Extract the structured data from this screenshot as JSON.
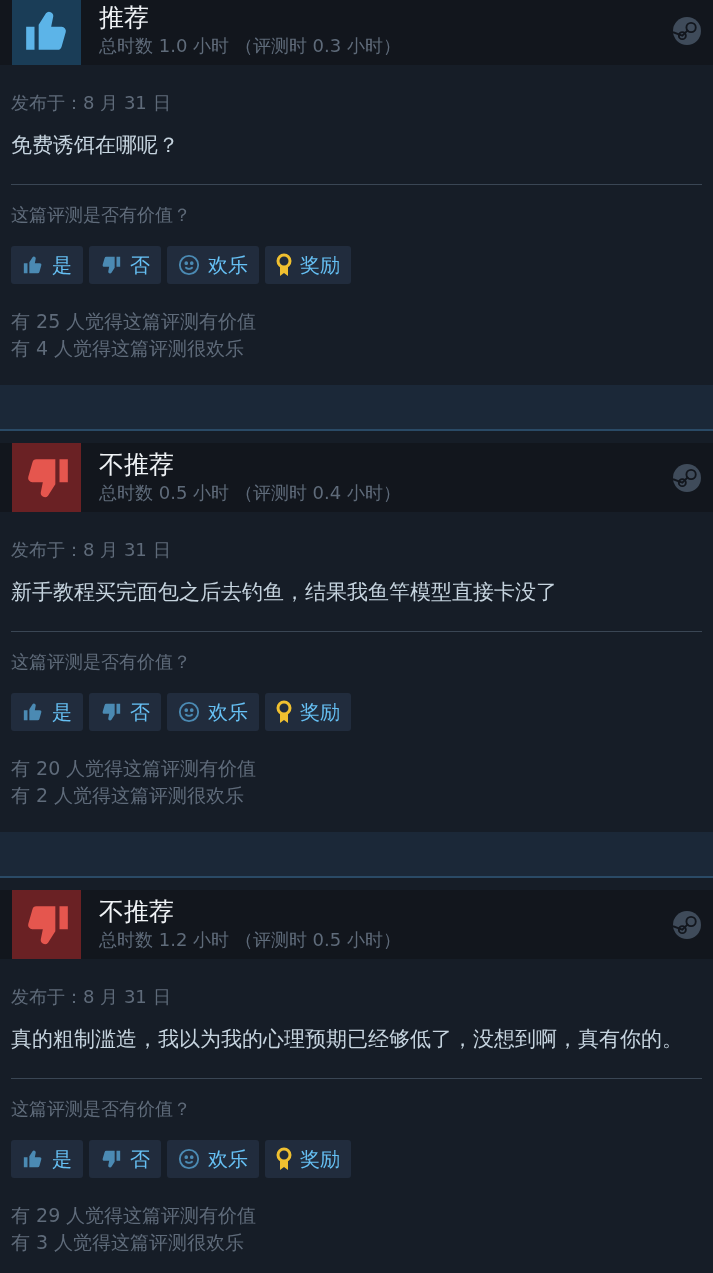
{
  "reviews": [
    {
      "kind": "recommended",
      "title": "推荐",
      "hours": "总时数 1.0 小时 （评测时 0.3 小时）",
      "posted": "发布于：8 月 31 日",
      "text": "免费诱饵在哪呢？",
      "question": "这篇评测是否有价值？",
      "buttons": [
        {
          "kind": "yes",
          "label": "是"
        },
        {
          "kind": "no",
          "label": "否"
        },
        {
          "kind": "funny",
          "label": "欢乐"
        },
        {
          "kind": "award",
          "label": "奖励"
        }
      ],
      "helpful": "有 25 人觉得这篇评测有价值",
      "funny": "有 4 人觉得这篇评测很欢乐"
    },
    {
      "kind": "not_recommended",
      "title": "不推荐",
      "hours": "总时数 0.5 小时 （评测时 0.4 小时）",
      "posted": "发布于：8 月 31 日",
      "text": "新手教程买完面包之后去钓鱼，结果我鱼竿模型直接卡没了",
      "question": "这篇评测是否有价值？",
      "buttons": [
        {
          "kind": "yes",
          "label": "是"
        },
        {
          "kind": "no",
          "label": "否"
        },
        {
          "kind": "funny",
          "label": "欢乐"
        },
        {
          "kind": "award",
          "label": "奖励"
        }
      ],
      "helpful": "有 20 人觉得这篇评测有价值",
      "funny": "有 2 人觉得这篇评测很欢乐"
    },
    {
      "kind": "not_recommended",
      "title": "不推荐",
      "hours": "总时数 1.2 小时 （评测时 0.5 小时）",
      "posted": "发布于：8 月 31 日",
      "text": "真的粗制滥造，我以为我的心理预期已经够低了，没想到啊，真有你的。",
      "question": "这篇评测是否有价值？",
      "buttons": [
        {
          "kind": "yes",
          "label": "是"
        },
        {
          "kind": "no",
          "label": "否"
        },
        {
          "kind": "funny",
          "label": "欢乐"
        },
        {
          "kind": "award",
          "label": "奖励"
        }
      ],
      "helpful": "有 29 人觉得这篇评测有价值",
      "funny": "有 3 人觉得这篇评测很欢乐"
    }
  ]
}
